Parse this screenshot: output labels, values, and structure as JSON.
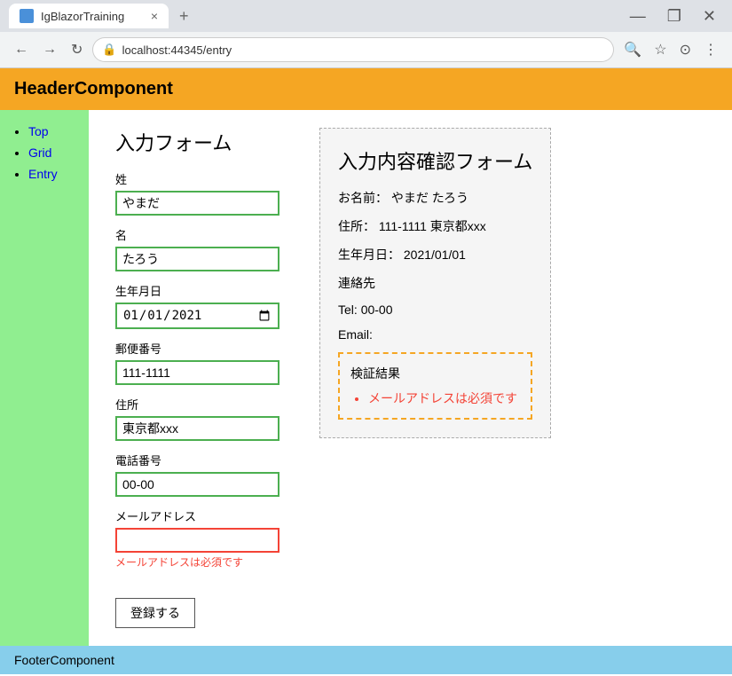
{
  "browser": {
    "tab_title": "IgBlazorTraining",
    "tab_close": "×",
    "new_tab": "+",
    "address": "localhost:44345/entry",
    "win_min": "—",
    "win_max": "❐",
    "win_close": "✕",
    "back_icon": "←",
    "forward_icon": "→",
    "reload_icon": "↻",
    "search_icon": "🔍",
    "star_icon": "☆",
    "profile_icon": "⊙",
    "menu_icon": "⋮",
    "lock_icon": "🔒"
  },
  "app": {
    "header": "HeaderComponent",
    "footer": "FooterComponent"
  },
  "sidebar": {
    "items": [
      {
        "label": "Top",
        "href": "#"
      },
      {
        "label": "Grid",
        "href": "#"
      },
      {
        "label": "Entry",
        "href": "#"
      }
    ]
  },
  "input_form": {
    "title": "入力フォーム",
    "fields": [
      {
        "label": "姓",
        "id": "last-name",
        "type": "text",
        "value": "やまだ",
        "error": false
      },
      {
        "label": "名",
        "id": "first-name",
        "type": "text",
        "value": "たろう",
        "error": false
      },
      {
        "label": "生年月日",
        "id": "birth-date",
        "type": "date",
        "value": "2021-01-01",
        "error": false
      },
      {
        "label": "郵便番号",
        "id": "postal-code",
        "type": "text",
        "value": "111-1111",
        "error": false
      },
      {
        "label": "住所",
        "id": "address",
        "type": "text",
        "value": "東京都xxx",
        "error": false
      },
      {
        "label": "電話番号",
        "id": "phone",
        "type": "text",
        "value": "00-00",
        "error": false
      },
      {
        "label": "メールアドレス",
        "id": "email",
        "type": "text",
        "value": "",
        "error": true,
        "error_message": "メールアドレスは必須です"
      }
    ],
    "submit_label": "登録する"
  },
  "confirm_panel": {
    "title": "入力内容確認フォーム",
    "name_label": "お名前：",
    "name_value": "やまだ たろう",
    "address_label": "住所：",
    "address_value": "111-1111 東京都xxx",
    "birthdate_label": "生年月日：",
    "birthdate_value": "2021/01/01",
    "contact_title": "連絡先",
    "tel_label": "Tel:",
    "tel_value": "00-00",
    "email_label": "Email:",
    "validation_box": {
      "title": "検証結果",
      "errors": [
        "メールアドレスは必須です"
      ]
    }
  }
}
